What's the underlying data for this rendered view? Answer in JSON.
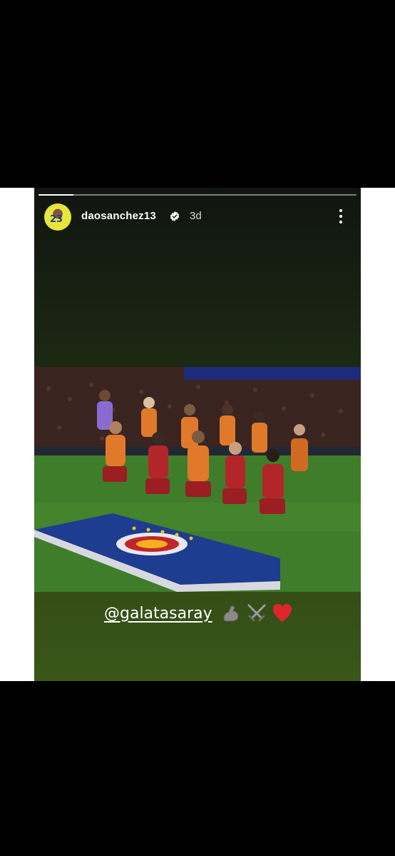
{
  "story": {
    "username": "daosanchez13",
    "time_ago": "3d",
    "avatar_number": "23",
    "progress": 0.11,
    "caption_mention": "@galatasaray",
    "caption_emojis": [
      "flexed-biceps-emoji",
      "crossed-swords-emoji",
      "red-heart-emoji"
    ]
  },
  "colors": {
    "background": "#000000",
    "side_panels": "#ffffff",
    "story_top": "#101510",
    "story_bottom": "#3a5718",
    "team_kit_orange": "#e07a2a",
    "team_kit_red": "#b2262a"
  },
  "icons": {
    "verified": "verified-badge-icon",
    "menu": "more-vertical-icon"
  }
}
